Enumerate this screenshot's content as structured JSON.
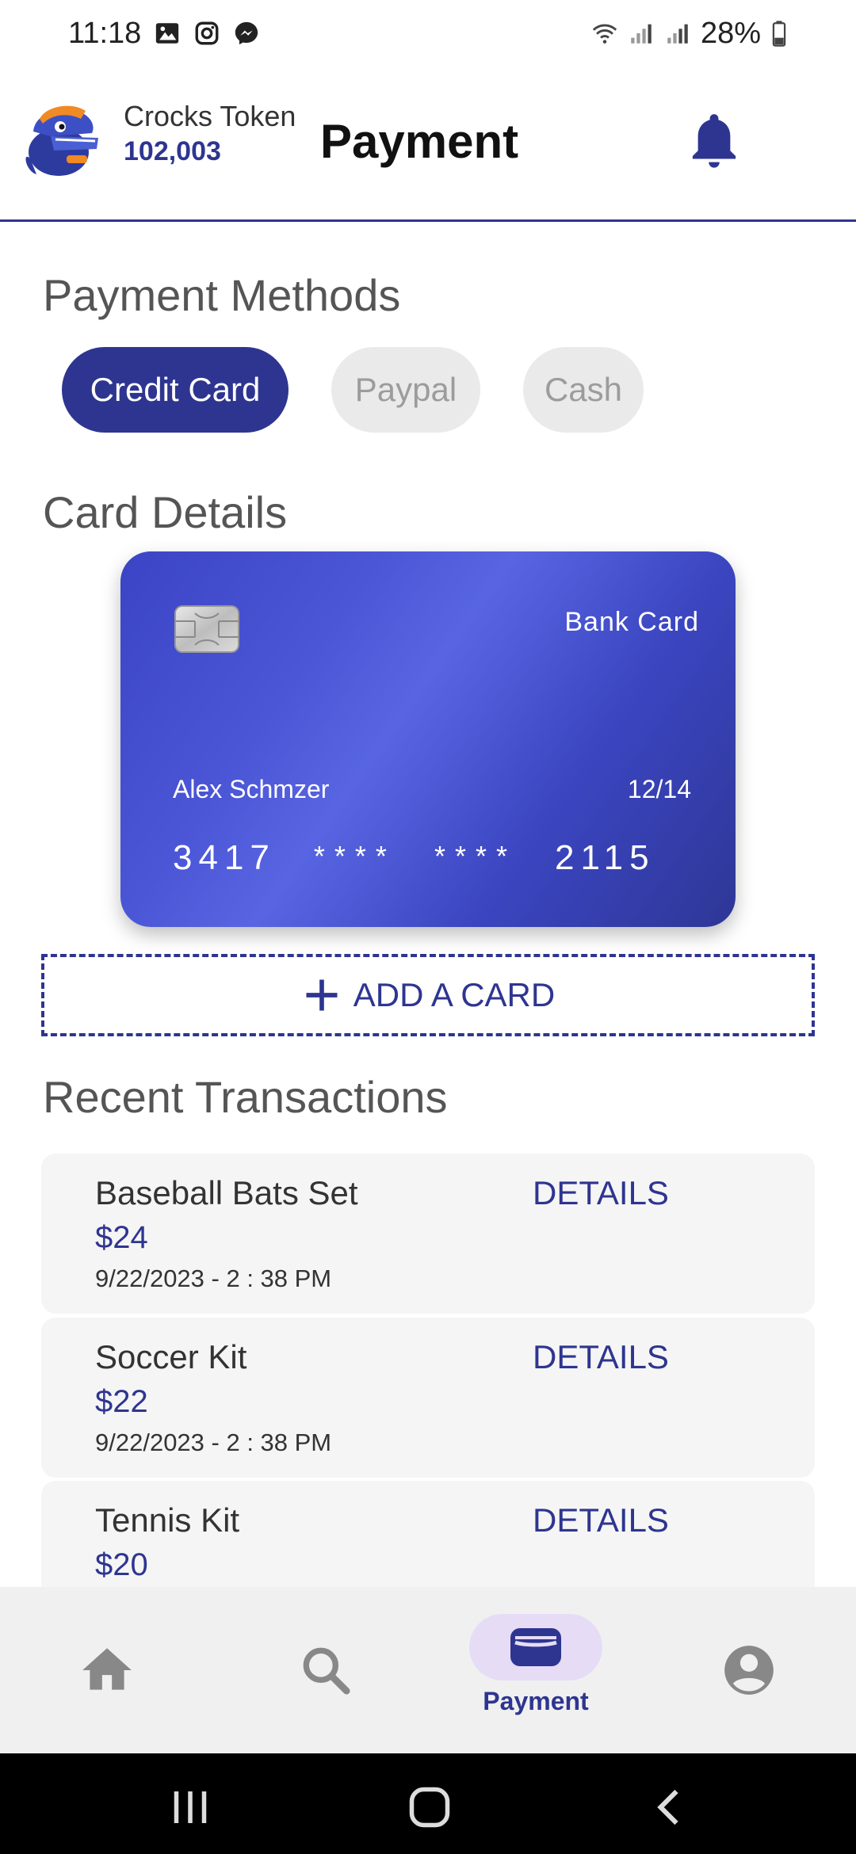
{
  "status_bar": {
    "time": "11:18",
    "battery": "28%",
    "icons_left": [
      "gallery-icon",
      "instagram-icon",
      "messenger-icon"
    ],
    "icons_right": [
      "wifi-icon",
      "signal-icon",
      "signal-icon",
      "battery-icon"
    ]
  },
  "header": {
    "token_label": "Crocks Token",
    "token_value": "102,003",
    "title": "Payment"
  },
  "payment_methods": {
    "title": "Payment Methods",
    "options": [
      "Credit Card",
      "Paypal",
      "Cash"
    ],
    "selected": "Credit Card"
  },
  "card_details": {
    "title": "Card Details",
    "brand": "Bank Card",
    "holder": "Alex Schmzer",
    "expiry": "12/14",
    "number_first": "3417",
    "number_mask_1": "****",
    "number_mask_2": "****",
    "number_last": "2115"
  },
  "add_card": {
    "label": "ADD A CARD"
  },
  "transactions": {
    "title": "Recent Transactions",
    "items": [
      {
        "name": "Baseball Bats Set",
        "price": "$24",
        "date": "9/22/2023 - 2 : 38 PM",
        "action": "DETAILS"
      },
      {
        "name": "Soccer Kit",
        "price": "$22",
        "date": "9/22/2023 - 2 : 38 PM",
        "action": "DETAILS"
      },
      {
        "name": "Tennis Kit",
        "price": "$20",
        "date": "",
        "action": "DETAILS"
      }
    ]
  },
  "bottom_nav": {
    "items": [
      {
        "icon": "home-icon"
      },
      {
        "icon": "search-icon"
      },
      {
        "icon": "wallet-icon",
        "label": "Payment"
      },
      {
        "icon": "profile-icon"
      }
    ],
    "active": "Payment"
  },
  "colors": {
    "accent": "#2e3590",
    "active_pill": "#e6dcf6",
    "chip_inactive": "#eaeaea"
  }
}
